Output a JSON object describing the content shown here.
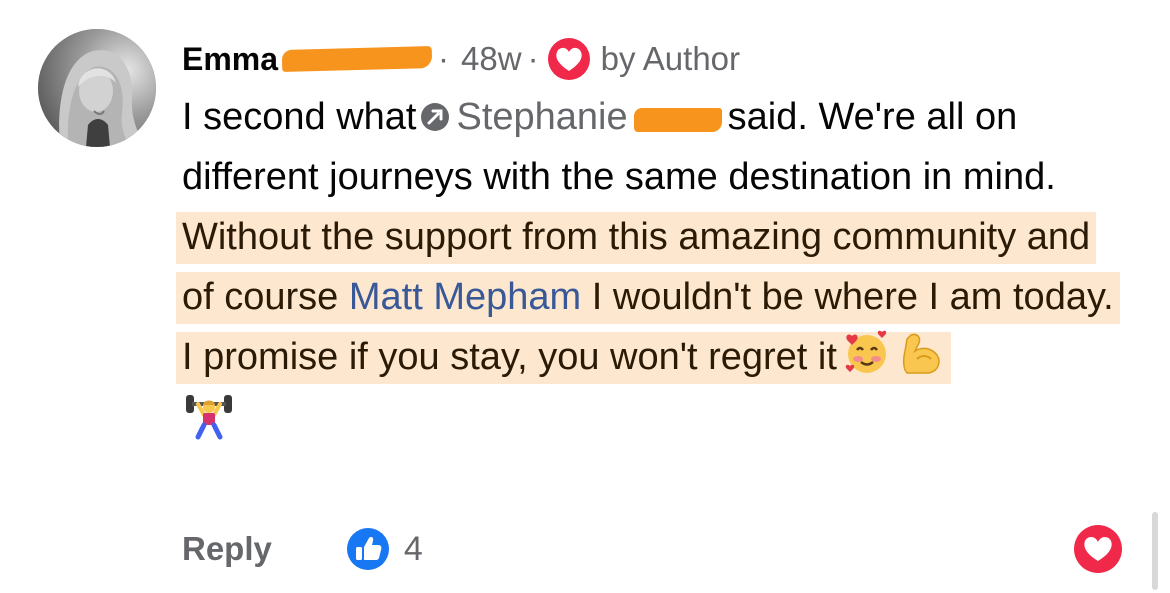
{
  "comment": {
    "author_first_name": "Emma",
    "separator_1": "·",
    "timestamp": "48w",
    "separator_2": "·",
    "liked_by_label": "by Author",
    "text": {
      "part_1": "I second what",
      "mention_1": "Stephanie",
      "part_2": "said. We're all on different journeys with the same destination in mind.",
      "highlighted_part_1": "Without the support from this amazing community and of course",
      "mention_2": "Matt Mepham",
      "highlighted_part_2": "I wouldn't be where I am today. I promise if you stay, you won't regret it"
    }
  },
  "actions": {
    "reply_label": "Reply",
    "like_count": "4"
  },
  "icons": {
    "avatar": "profile-photo",
    "liked_by_author": "heart-icon",
    "mention_tag": "tag-icon",
    "emoji_1": "smiling-face-with-hearts",
    "emoji_2": "flexed-biceps",
    "emoji_3": "person-lifting-weights",
    "like": "thumbs-up-icon",
    "react": "heart-icon"
  },
  "colors": {
    "highlight": "#fde8cf",
    "mention": "#385898",
    "like_blue": "#1877f2",
    "heart_red": "#f0284a",
    "secondary_text": "#65676b",
    "redaction": "#f7941d"
  }
}
